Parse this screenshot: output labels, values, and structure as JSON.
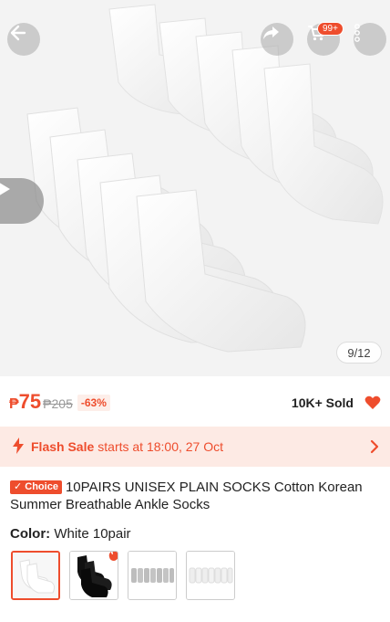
{
  "gallery": {
    "counter": "9/12",
    "cart_badge": "99+",
    "icons": [
      "back-arrow-icon",
      "share-icon",
      "cart-icon",
      "more-icon",
      "play-icon"
    ]
  },
  "price": {
    "currency": "₱",
    "current": "75",
    "original": "₱205",
    "discount": "-63%",
    "sold": "10K+ Sold"
  },
  "flash_sale": {
    "title": "Flash Sale",
    "info": "starts at 18:00, 27 Oct"
  },
  "product": {
    "badge": "✓ Choice",
    "title": "10PAIRS UNISEX PLAIN SOCKS Cotton Korean Summer Breathable Ankle Socks"
  },
  "color": {
    "label": "Color:",
    "selected": "White 10pair",
    "options": [
      "White 10pair",
      "Black 10pair",
      "Grey 10pair",
      "White Stripe 10pair"
    ]
  },
  "colors": {
    "accent": "#ee4d2d",
    "flash_bg": "#fdeae4"
  }
}
